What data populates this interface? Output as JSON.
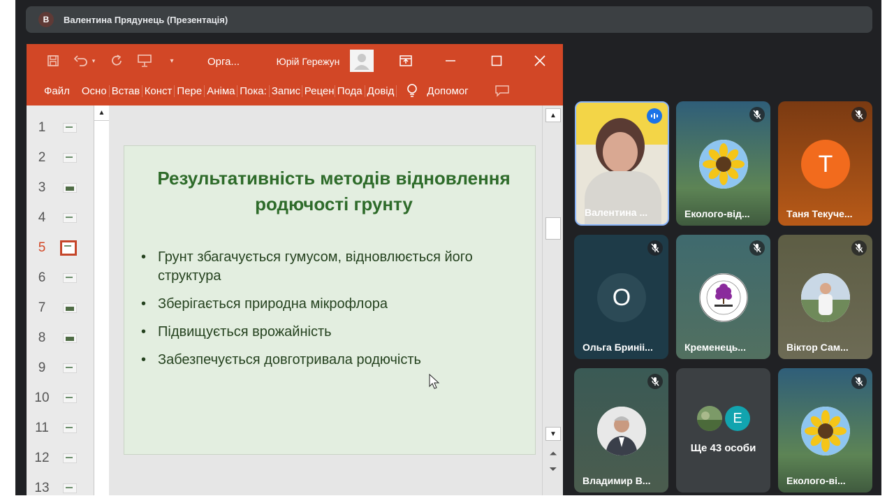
{
  "meet": {
    "presenter_initial": "В",
    "presenter_title": "Валентина Прядунець (Презентація)"
  },
  "ppt": {
    "doc_title": "Орга...",
    "user_name": "Юрій Гережун",
    "ribbon_tabs": [
      "Файл",
      "Осно",
      "Встав",
      "Конст",
      "Пере",
      "Аніма",
      "Пока:",
      "Запис",
      "Рецен",
      "Пода",
      "Довід"
    ],
    "help_label": "Допомог",
    "slide_numbers": [
      "1",
      "2",
      "3",
      "4",
      "5",
      "6",
      "7",
      "8",
      "9",
      "10",
      "11",
      "12",
      "13"
    ],
    "active_slide": "5",
    "slide": {
      "title": "Результативність методів відновлення родючості грунту",
      "bullets": [
        "Грунт збагачується гумусом, відновлюється його структура",
        "Зберігається природна мікрофлора",
        "Підвищується врожайність",
        "Забезпечується довготривала родючість"
      ]
    }
  },
  "participants": [
    {
      "name": "Валентина ...",
      "mic": "speaking"
    },
    {
      "name": "Еколого-від...",
      "mic": "muted"
    },
    {
      "name": "Таня Текуче...",
      "mic": "muted",
      "initial": "Т"
    },
    {
      "name": "Ольга Бриніі...",
      "mic": "muted",
      "initial": "О"
    },
    {
      "name": "Кременець...",
      "mic": "muted"
    },
    {
      "name": "Віктор Сам...",
      "mic": "muted"
    },
    {
      "name": "Владимир В...",
      "mic": "muted"
    },
    {
      "name": "Ще 43 особи",
      "initial": "Е"
    },
    {
      "name": "Еколого-ві...",
      "mic": "muted"
    }
  ],
  "colors": {
    "ppt_accent": "#d24726",
    "slide_title": "#2e6b2a",
    "speaking_blue": "#1a73e8",
    "tanya_avatar": "#f26b1d",
    "olga_avatar": "#3c4043",
    "e_avatar": "#12a4af"
  }
}
